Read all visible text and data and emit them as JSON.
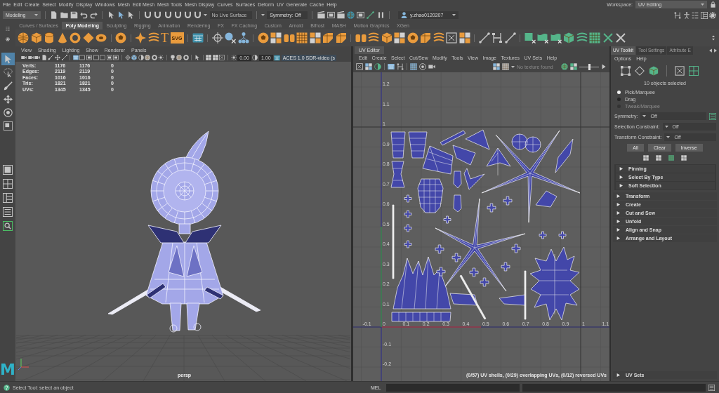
{
  "menu_bar": {
    "items": [
      "File",
      "Edit",
      "Create",
      "Select",
      "Modify",
      "Display",
      "Windows",
      "Mesh",
      "Edit Mesh",
      "Mesh Tools",
      "Mesh Display",
      "Curves",
      "Surfaces",
      "Deform",
      "UV",
      "Generate",
      "Cache",
      "Help"
    ],
    "workspace_label": "Workspace:",
    "workspace": "UV Editing"
  },
  "status_line": {
    "menu_set": "Modeling",
    "live_surface": "No Live Surface",
    "symmetry": "Symmetry: Off",
    "user": "y.zhao0120207"
  },
  "shelf": {
    "tabs": [
      {
        "label": "Curves / Surfaces",
        "selected": false
      },
      {
        "label": "Poly Modeling",
        "selected": true
      },
      {
        "label": "Sculpting",
        "selected": false
      },
      {
        "label": "Rigging",
        "selected": false
      },
      {
        "label": "Animation",
        "selected": false
      },
      {
        "label": "Rendering",
        "selected": false
      },
      {
        "label": "FX",
        "selected": false
      },
      {
        "label": "FX Caching",
        "selected": false
      },
      {
        "label": "Custom",
        "selected": false
      },
      {
        "label": "Arnold",
        "selected": false
      },
      {
        "label": "Bifrost",
        "selected": false
      },
      {
        "label": "MASH",
        "selected": false
      },
      {
        "label": "Motion Graphics",
        "selected": false
      },
      {
        "label": "XGen",
        "selected": false
      }
    ],
    "type_tool": "T",
    "svg_tool": "SVG"
  },
  "toolbox": {
    "tools": [
      {
        "selected": true
      },
      {
        "selected": false
      },
      {
        "selected": false
      },
      {
        "selected": false
      },
      {
        "selected": false
      },
      {
        "selected": false
      }
    ],
    "logo": "M"
  },
  "viewport": {
    "menu": [
      "View",
      "Shading",
      "Lighting",
      "Show",
      "Renderer",
      "Panels"
    ],
    "exposure": "0.00",
    "gamma": "1.00",
    "color_space": "ACES 1.0 SDR-video (s",
    "stats": [
      {
        "label": "Verts:",
        "values": [
          "1176",
          "1176",
          "0"
        ]
      },
      {
        "label": "Edges:",
        "values": [
          "2119",
          "2119",
          "0"
        ]
      },
      {
        "label": "Faces:",
        "values": [
          "1016",
          "1016",
          "0"
        ]
      },
      {
        "label": "Tris:",
        "values": [
          "1821",
          "1821",
          "0"
        ]
      },
      {
        "label": "UVs:",
        "values": [
          "1345",
          "1345",
          "0"
        ]
      }
    ],
    "camera": "persp"
  },
  "uv_editor": {
    "title": "UV Editor",
    "menu": [
      "Edit",
      "Create",
      "Select",
      "Cut/Sew",
      "Modify",
      "Tools",
      "View",
      "Image",
      "Textures",
      "UV Sets",
      "Help"
    ],
    "texture": "No texture found",
    "image_slider": {
      "level": 0.5
    },
    "u_labels": [
      "-0.1",
      "0",
      "0.1",
      "0.2",
      "0.3",
      "0.4",
      "0.5",
      "0.6",
      "0.7",
      "0.8",
      "0.9",
      "1",
      "1.1"
    ],
    "v_labels": [
      "1.2",
      "1.1",
      "1",
      "0.9",
      "0.8",
      "0.7",
      "0.6",
      "0.5",
      "0.4",
      "0.3",
      "0.2",
      "0.1",
      "-0.1",
      "-0.2"
    ],
    "summary": "(0/57) UV shells, (0/29) overlapping UVs, (0/12) reversed UVs"
  },
  "uv_toolkit": {
    "tabs": [
      {
        "label": "UV Toolkit",
        "selected": true
      },
      {
        "label": "Tool Settings",
        "selected": false
      },
      {
        "label": "Attribute E",
        "selected": false
      }
    ],
    "menu": [
      "Options",
      "Help"
    ],
    "selection_info": "10 objects selected",
    "select_modes": [
      {
        "label": "Pick/Marquee",
        "selected": true,
        "disabled": false
      },
      {
        "label": "Drag",
        "selected": false,
        "disabled": false
      },
      {
        "label": "Tweak/Marquee",
        "selected": false,
        "disabled": true
      }
    ],
    "options": [
      {
        "label": "Symmetry:",
        "value": "Off"
      },
      {
        "label": "Selection Constraint:",
        "value": "Off"
      },
      {
        "label": "Transform Constraint:",
        "value": "Off"
      }
    ],
    "buttons": [
      "All",
      "Clear",
      "Inverse"
    ],
    "selection_sections": [
      {
        "label": "Pinning",
        "expanded": false
      },
      {
        "label": "Select By Type",
        "expanded": false
      },
      {
        "label": "Soft Selection",
        "expanded": false
      }
    ],
    "sections": [
      {
        "label": "Transform",
        "expanded": false
      },
      {
        "label": "Create",
        "expanded": false
      },
      {
        "label": "Cut and Sew",
        "expanded": false
      },
      {
        "label": "Unfold",
        "expanded": false
      },
      {
        "label": "Align and Snap",
        "expanded": false
      },
      {
        "label": "Arrange and Layout",
        "expanded": false
      }
    ],
    "footer_section": {
      "label": "UV Sets",
      "expanded": false
    }
  },
  "help_line": {
    "message": "Select Tool: select an object",
    "command_language": "MEL"
  }
}
